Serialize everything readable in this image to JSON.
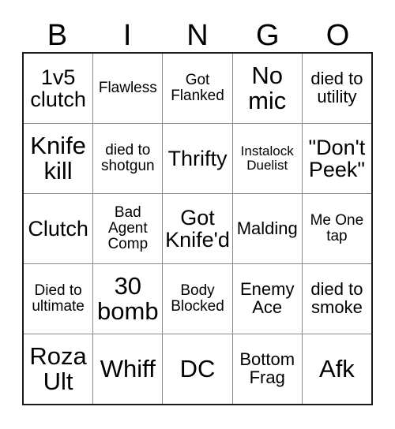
{
  "card": {
    "title": "BINGO",
    "headers": [
      "B",
      "I",
      "N",
      "G",
      "O"
    ],
    "text_color": "#000000",
    "border_color": "#888888",
    "outer_border_color": "#1a1a1a",
    "background_color": "#ffffff",
    "rows": [
      [
        {
          "text": "1v5 clutch",
          "size": "lg"
        },
        {
          "text": "Flawless",
          "size": "sm"
        },
        {
          "text": "Got Flanked",
          "size": "sm"
        },
        {
          "text": "No mic",
          "size": "xl"
        },
        {
          "text": "died to utility",
          "size": "md"
        }
      ],
      [
        {
          "text": "Knife kill",
          "size": "xl"
        },
        {
          "text": "died to shotgun",
          "size": "sm"
        },
        {
          "text": "Thrifty",
          "size": "lg"
        },
        {
          "text": "Instalock Duelist",
          "size": "xs"
        },
        {
          "text": "\"Don't Peek\"",
          "size": "lg"
        }
      ],
      [
        {
          "text": "Clutch",
          "size": "lg"
        },
        {
          "text": "Bad Agent Comp",
          "size": "sm"
        },
        {
          "text": "Got Knife'd",
          "size": "lg"
        },
        {
          "text": "Malding",
          "size": "md"
        },
        {
          "text": "Me One tap",
          "size": "sm"
        }
      ],
      [
        {
          "text": "Died to ultimate",
          "size": "sm"
        },
        {
          "text": "30 bomb",
          "size": "xl"
        },
        {
          "text": "Body Blocked",
          "size": "sm"
        },
        {
          "text": "Enemy Ace",
          "size": "md"
        },
        {
          "text": "died to smoke",
          "size": "md"
        }
      ],
      [
        {
          "text": "Roza Ult",
          "size": "xl"
        },
        {
          "text": "Whiff",
          "size": "xl"
        },
        {
          "text": "DC",
          "size": "xl"
        },
        {
          "text": "Bottom Frag",
          "size": "md"
        },
        {
          "text": "Afk",
          "size": "xl"
        }
      ]
    ]
  }
}
